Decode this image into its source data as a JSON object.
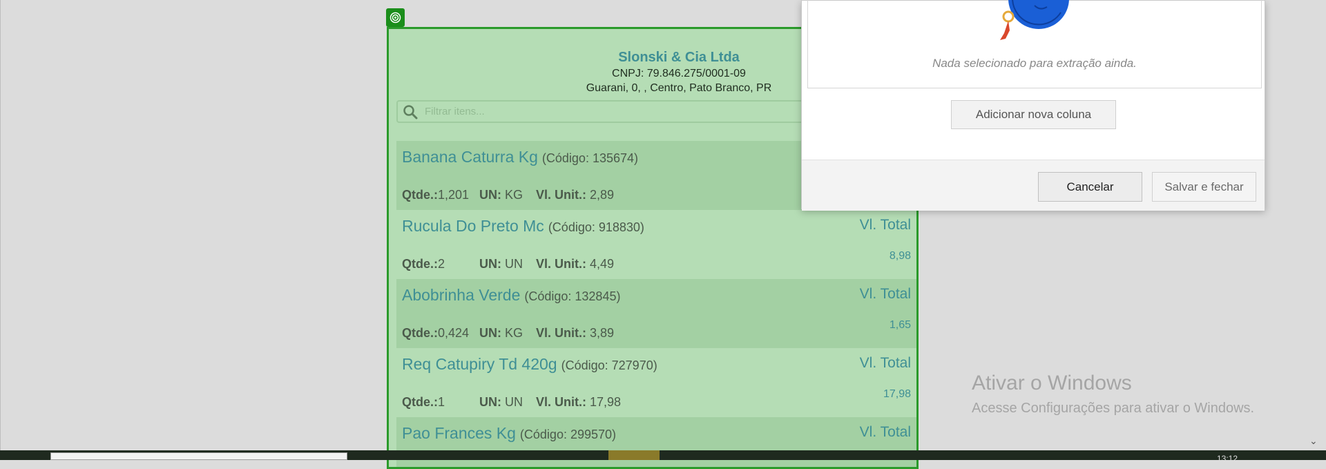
{
  "store": {
    "name": "Slonski & Cia Ltda",
    "cnpj": "CNPJ: 79.846.275/0001-09",
    "address": "Guarani, 0, , Centro, Pato Branco, PR"
  },
  "search": {
    "placeholder": "Filtrar itens..."
  },
  "labels": {
    "qty": "Qtde.:",
    "unit": "UN:",
    "unit_price": "Vl. Unit.:",
    "total": "Vl. Total"
  },
  "items": [
    {
      "name": "Banana Caturra Kg",
      "code": "(Código: 135674)",
      "qty": "1,201",
      "unit": "KG",
      "unit_price": "2,89",
      "total": ""
    },
    {
      "name": "Rucula Do Preto Mc",
      "code": "(Código: 918830)",
      "qty": "2",
      "unit": "UN",
      "unit_price": "4,49",
      "total": "8,98"
    },
    {
      "name": "Abobrinha Verde",
      "code": "(Código: 132845)",
      "qty": "0,424",
      "unit": "KG",
      "unit_price": "3,89",
      "total": "1,65"
    },
    {
      "name": "Req Catupiry Td 420g",
      "code": "(Código: 727970)",
      "qty": "1",
      "unit": "UN",
      "unit_price": "17,98",
      "total": "17,98"
    },
    {
      "name": "Pao Frances Kg",
      "code": "(Código: 299570)",
      "qty": "",
      "unit": "",
      "unit_price": "",
      "total": ""
    }
  ],
  "dialog": {
    "empty_message": "Nada selecionado para extração ainda.",
    "add_column": "Adicionar nova coluna",
    "cancel": "Cancelar",
    "save_close": "Salvar e fechar"
  },
  "watermark": {
    "title": "Ativar o Windows",
    "subtitle": "Acesse Configurações para ativar o Windows."
  },
  "taskbar": {
    "clock": "13:12"
  },
  "colors": {
    "selection_green": "#2a9a2a",
    "receipt_bg": "#b5ddb5",
    "accent_text": "#3f8f95"
  }
}
